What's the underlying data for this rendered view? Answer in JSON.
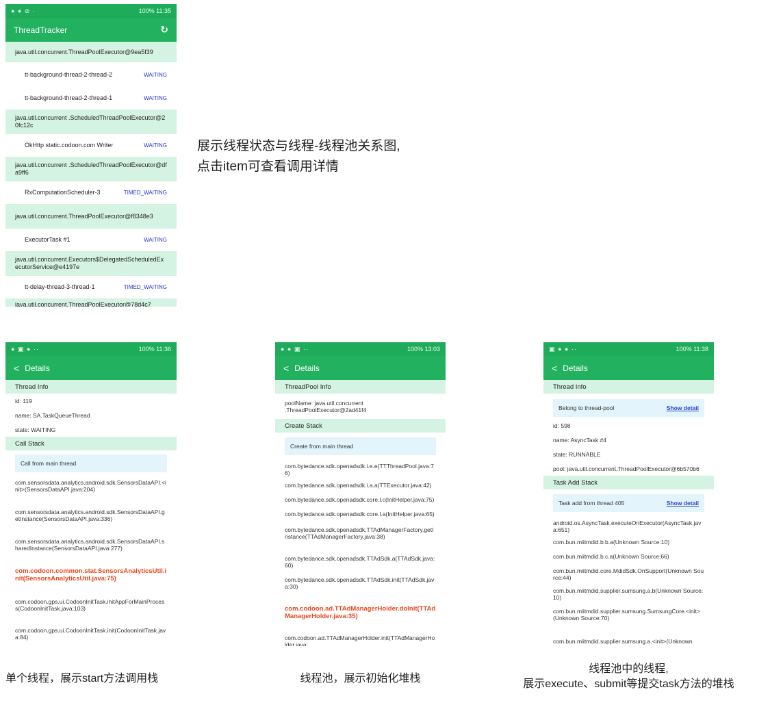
{
  "main_phone": {
    "status_time": "100% 11:35",
    "title": "ThreadTracker",
    "rows": [
      {
        "kind": "group",
        "text": "java.util.concurrent.ThreadPoolExecutor@9ea5f39"
      },
      {
        "kind": "thread",
        "name": "tt-background-thread-2-thread-2",
        "state": "WAITING"
      },
      {
        "kind": "thread",
        "name": "tt-background-thread-2-thread-1",
        "state": "WAITING"
      },
      {
        "kind": "group",
        "text": "java.util.concurrent .ScheduledThreadPoolExecutor@20fc12c"
      },
      {
        "kind": "thread",
        "name": "OkHttp static.codoon.com Writer",
        "state": "WAITING"
      },
      {
        "kind": "group",
        "text": "java.util.concurrent .ScheduledThreadPoolExecutor@dfa9ff6"
      },
      {
        "kind": "thread",
        "name": "RxComputationScheduler-3",
        "state": "TIMED_WAITING"
      },
      {
        "kind": "group",
        "text": "java.util.concurrent.ThreadPoolExecutor@f8348e3"
      },
      {
        "kind": "thread",
        "name": "ExecutorTask #1",
        "state": "WAITING"
      },
      {
        "kind": "group",
        "text": "java.util.concurrent.Executors$DelegatedScheduledExecutorService@e4197e"
      },
      {
        "kind": "thread",
        "name": "tt-delay-thread-3-thread-1",
        "state": "TIMED_WAITING"
      },
      {
        "kind": "group",
        "text": "java.util.concurrent.ThreadPoolExecutor@78d4c7"
      }
    ]
  },
  "description": {
    "line1": "展示线程状态与线程-线程池关系图,",
    "line2": "点击item可查看调用详情"
  },
  "detail_thread": {
    "status_time": "100% 11:36",
    "title": "Details",
    "section1": "Thread Info",
    "id": "id: 119",
    "name": "name: SA.TaskQueueThread",
    "state": "state: WAITING",
    "section2": "Call Stack",
    "callout": "Call from main thread",
    "stack": [
      {
        "text": "com.sensorsdata.analytics.android.sdk.SensorsDataAPI.<init>(SensorsDataAPI.java:204)",
        "hl": false
      },
      {
        "text": "com.sensorsdata.analytics.android.sdk.SensorsDataAPI.getInstance(SensorsDataAPI.java:336)",
        "hl": false
      },
      {
        "text": "com.sensorsdata.analytics.android.sdk.SensorsDataAPI.sharedInstance(SensorsDataAPI.java:277)",
        "hl": false
      },
      {
        "text": "com.codoon.common.stat.SensorsAnalyticsUtil.init(SensorsAnalyticsUtil.java:75)",
        "hl": true
      },
      {
        "text": "com.codoon.gps.ui.CodoonInitTask.initAppForMainProcess(CodoonInitTask.java:103)",
        "hl": false
      },
      {
        "text": "com.codoon.gps.ui.CodoonInitTask.init(CodoonInitTask.java:84)",
        "hl": false
      }
    ],
    "caption": "单个线程，展示start方法调用栈"
  },
  "detail_pool": {
    "status_time": "100% 13:03",
    "title": "Details",
    "section1": "ThreadPool Info",
    "pool_name": "poolName: java.util.concurrent .ThreadPoolExecutor@2ad41f4",
    "section2": "Create Stack",
    "callout": "Create from main thread",
    "stack": [
      {
        "text": "com.bytedance.sdk.openadsdk.i.e.e(TTThreadPool.java:76)",
        "hl": false
      },
      {
        "text": "com.bytedance.sdk.openadsdk.i.a.a(TTExecutor.java:42)",
        "hl": false
      },
      {
        "text": "com.bytedance.sdk.openadsdk.core.l.c(InitHelper.java:75)",
        "hl": false
      },
      {
        "text": "com.bytedance.sdk.openadsdk.core.l.a(InitHelper.java:65)",
        "hl": false
      },
      {
        "text": "com.bytedance.sdk.openadsdk.TTAdManagerFactory.getInstance(TTAdManagerFactory.java:38)",
        "hl": false
      },
      {
        "text": "com.bytedance.sdk.openadsdk.TTAdSdk.a(TTAdSdk.java:60)",
        "hl": false
      },
      {
        "text": "com.bytedance.sdk.openadsdk.TTAdSdk.init(TTAdSdk.java:30)",
        "hl": false
      },
      {
        "text": "com.codoon.ad.TTAdManagerHolder.doInit(TTAdManagerHolder.java:35)",
        "hl": true
      },
      {
        "text": "com.codoon.ad.TTAdManagerHolder.init(TTAdManagerHolder.java:",
        "hl": false
      }
    ],
    "caption": "线程池，展示初始化堆栈"
  },
  "detail_pool_thread": {
    "status_time": "100% 11:38",
    "title": "Details",
    "section1": "Thread Info",
    "callout1": "Belong to thread-pool",
    "show_detail": "Show detail",
    "id": "id: 598",
    "name": "name: AsyncTask #4",
    "state": "state: RUNNABLE",
    "pool": "pool: java.util.concurrent.ThreadPoolExecutor@6b570b6",
    "section2": "Task Add Stack",
    "callout2": "Task add from thread 405",
    "stack": [
      {
        "text": "android.os.AsyncTask.executeOnExecutor(AsyncTask.java:651)",
        "hl": false
      },
      {
        "text": "com.bun.miitmdid.b.b.a(Unknown Source:10)",
        "hl": false
      },
      {
        "text": "com.bun.miitmdid.b.c.a(Unknown Source:66)",
        "hl": false
      },
      {
        "text": "com.bun.miitmdid.core.MdidSdk.OnSupport(Unknown Source:44)",
        "hl": false
      },
      {
        "text": "com.bun.miitmdid.supplier.sumsung.a.b(Unknown Source:10)",
        "hl": false
      },
      {
        "text": "com.bun.miitmdid.supplier.sumsung.SumsungCore.<init>(Unknown Source:70)",
        "hl": false
      },
      {
        "text": "com.bun.miitmdid.supplier.sumsung.a.<init>(Unknown",
        "hl": false
      }
    ],
    "caption_line1": "线程池中的线程,",
    "caption_line2": "展示execute、submit等提交task方法的堆栈"
  },
  "colors": {
    "accent": "#22b15f",
    "section_bg": "#d5f3e3",
    "callout_bg": "#e3f4fc",
    "highlight": "#e8461d",
    "state_text": "#2233cc"
  }
}
